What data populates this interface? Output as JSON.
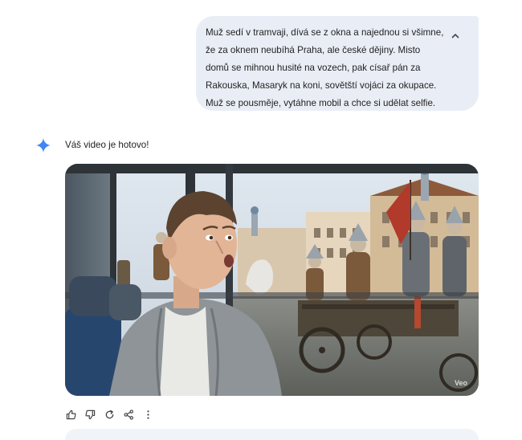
{
  "prompt": {
    "lines": [
      "Muž sedí v tramvaji, dívá se z okna a najednou si všimne,",
      "že za oknem neubíhá Praha, ale české dějiny. Misto",
      "domů se mihnou husité na vozech, pak císař pán za",
      "Rakouska, Masaryk na koni, sovětští vojáci za okupace.",
      "Muž se pousměje, vytáhne mobil a chce si udělat selfie."
    ]
  },
  "response": {
    "text": "Váš video je hotovo!",
    "video": {
      "watermark": "Veo"
    }
  },
  "icons": {
    "collapse": "chevron-up-icon",
    "assistant": "sparkle-icon",
    "actions": [
      "thumb-up-icon",
      "thumb-down-icon",
      "redo-icon",
      "share-icon",
      "more-vert-icon"
    ]
  },
  "colors": {
    "bubble": "#e9eef6",
    "spark": "#4285f4",
    "icon": "#444746"
  }
}
